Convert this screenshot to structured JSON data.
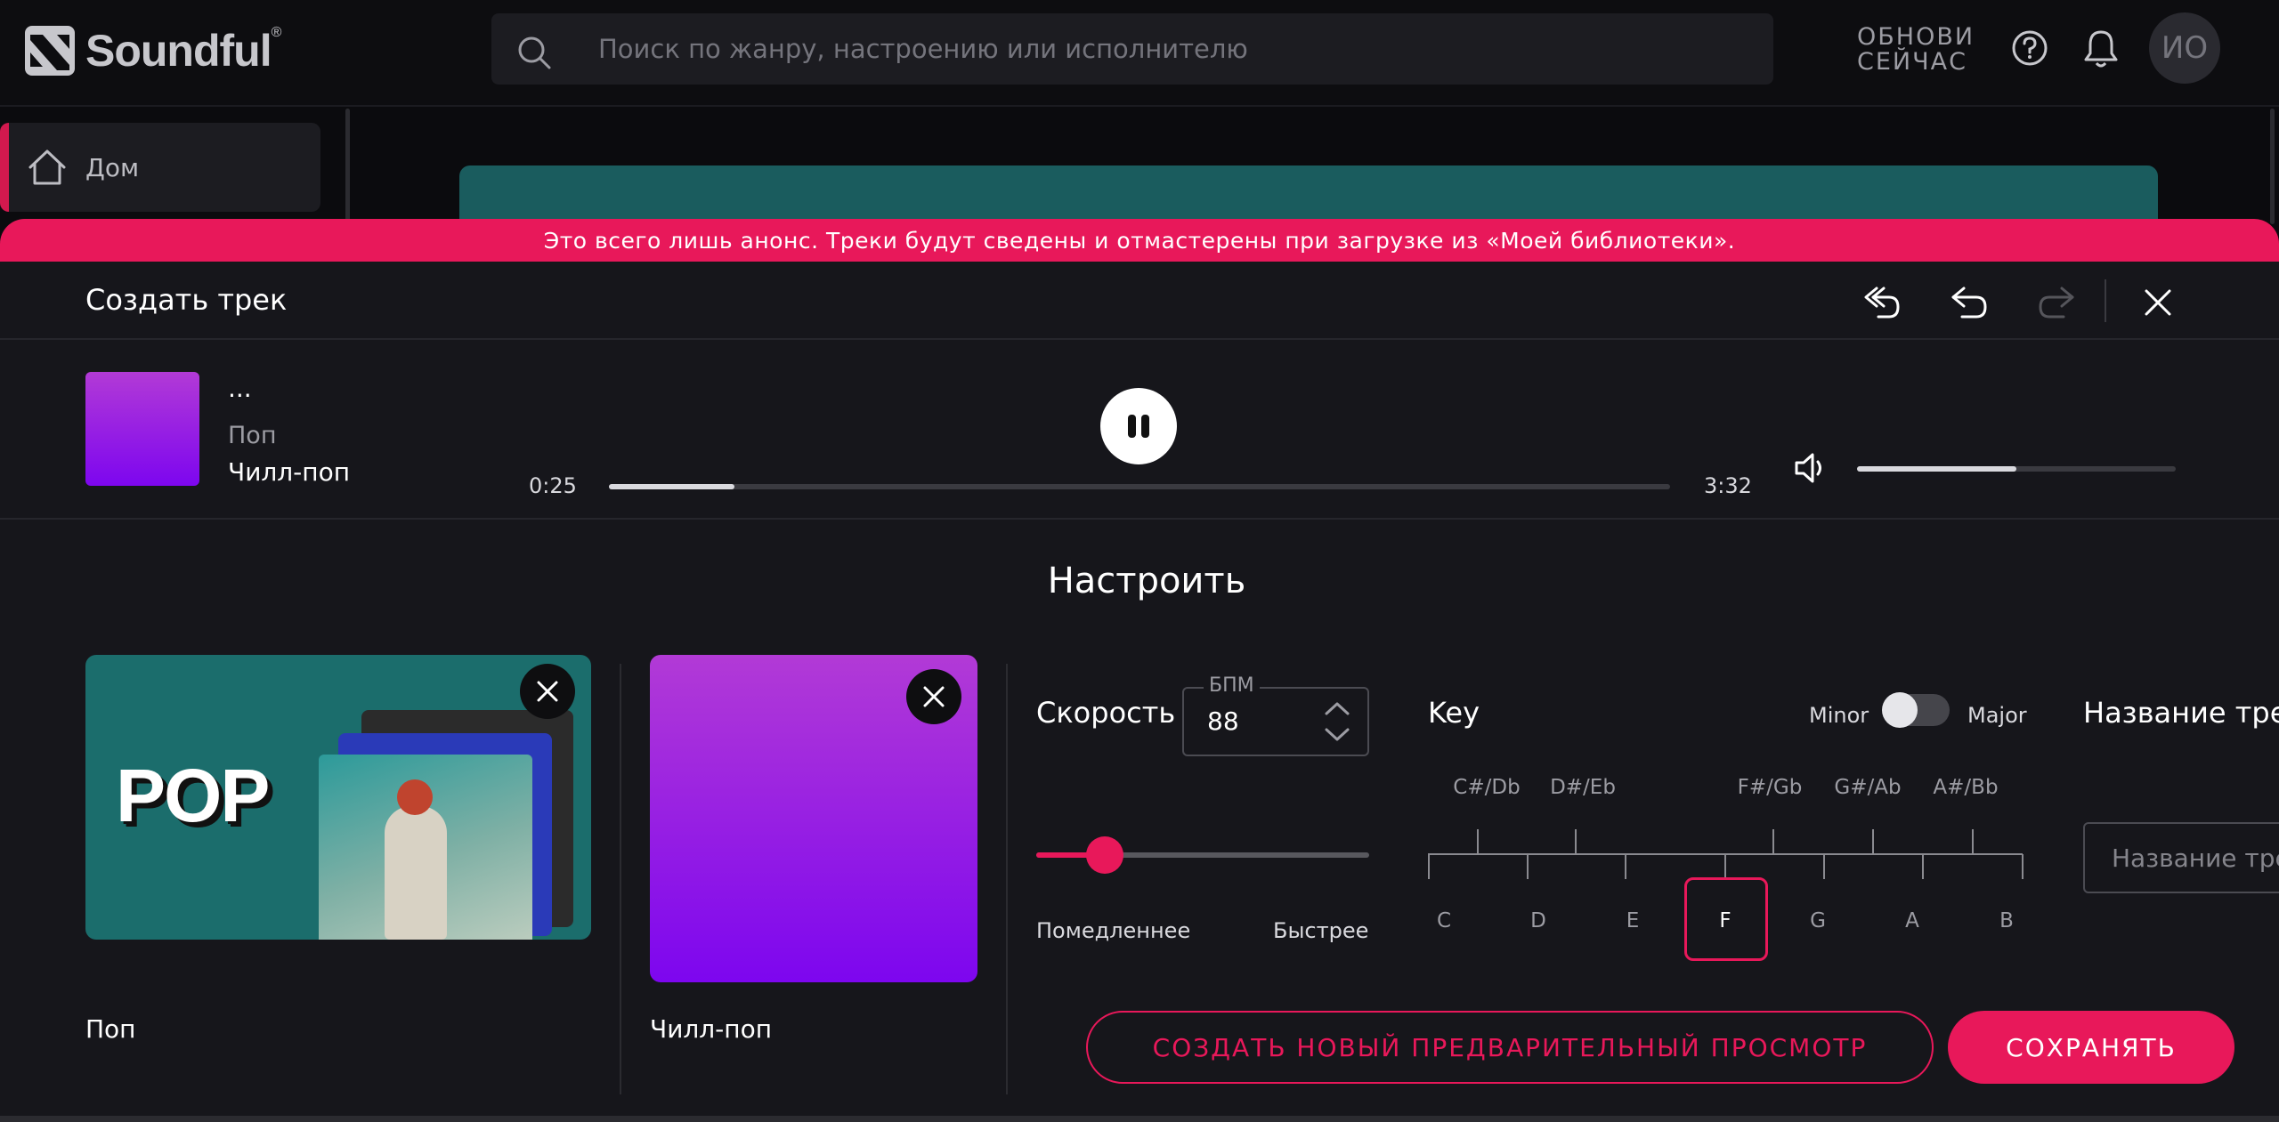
{
  "header": {
    "logo_text": "Soundful",
    "logo_mark": "®",
    "search_placeholder": "Поиск по жанру, настроению или исполнителю",
    "upgrade_line1": "ОБНОВИ",
    "upgrade_line2": "СЕЙЧАС",
    "help_icon": "help-circle-icon",
    "bell_icon": "bell-icon",
    "avatar_initials": "ИО"
  },
  "sidebar": {
    "items": [
      {
        "label": "Дом",
        "icon": "home-icon",
        "active": true
      }
    ]
  },
  "modal": {
    "notice": "Это всего лишь анонс. Треки будут сведены и отмастерены при загрузке из «Моей библиотеки».",
    "title": "Создать трек",
    "header_icons": [
      "undo-all-icon",
      "undo-icon",
      "redo-icon",
      "close-icon"
    ],
    "player": {
      "track_name": "...",
      "genre": "Поп",
      "subgenre": "Чилл-поп",
      "current_time": "0:25",
      "total_time": "3:32",
      "progress": 0.118,
      "volume": 0.5,
      "state": "playing"
    },
    "customize_title": "Настроить",
    "genre_card": {
      "label": "Поп",
      "art_text": "POP"
    },
    "subgenre_card": {
      "label": "Чилл-поп"
    },
    "tempo": {
      "label": "Скорость",
      "bpm_label": "БПМ",
      "bpm_value": "88",
      "slider_value": 0.205,
      "slower": "Помедленнее",
      "faster": "Быстрее"
    },
    "key": {
      "label": "Key",
      "minor": "Minor",
      "major": "Major",
      "mode": "Minor",
      "sharps": [
        "C#/Db",
        "D#/Eb",
        "F#/Gb",
        "G#/Ab",
        "A#/Bb"
      ],
      "naturals": [
        "C",
        "D",
        "E",
        "F",
        "G",
        "A",
        "B"
      ],
      "selected": "F"
    },
    "track_name_label": "Название трека",
    "track_name_placeholder": "Название трека",
    "preview_button": "СОЗДАТЬ НОВЫЙ ПРЕДВАРИТЕЛЬНЫЙ ПРОСМОТР",
    "save_button": "СОХРАНЯТЬ"
  },
  "colors": {
    "accent": "#e8185a",
    "background": "#16161b",
    "teal": "#1b6d6c",
    "purple_top": "#b23ad6",
    "purple_bottom": "#7d06ef"
  }
}
